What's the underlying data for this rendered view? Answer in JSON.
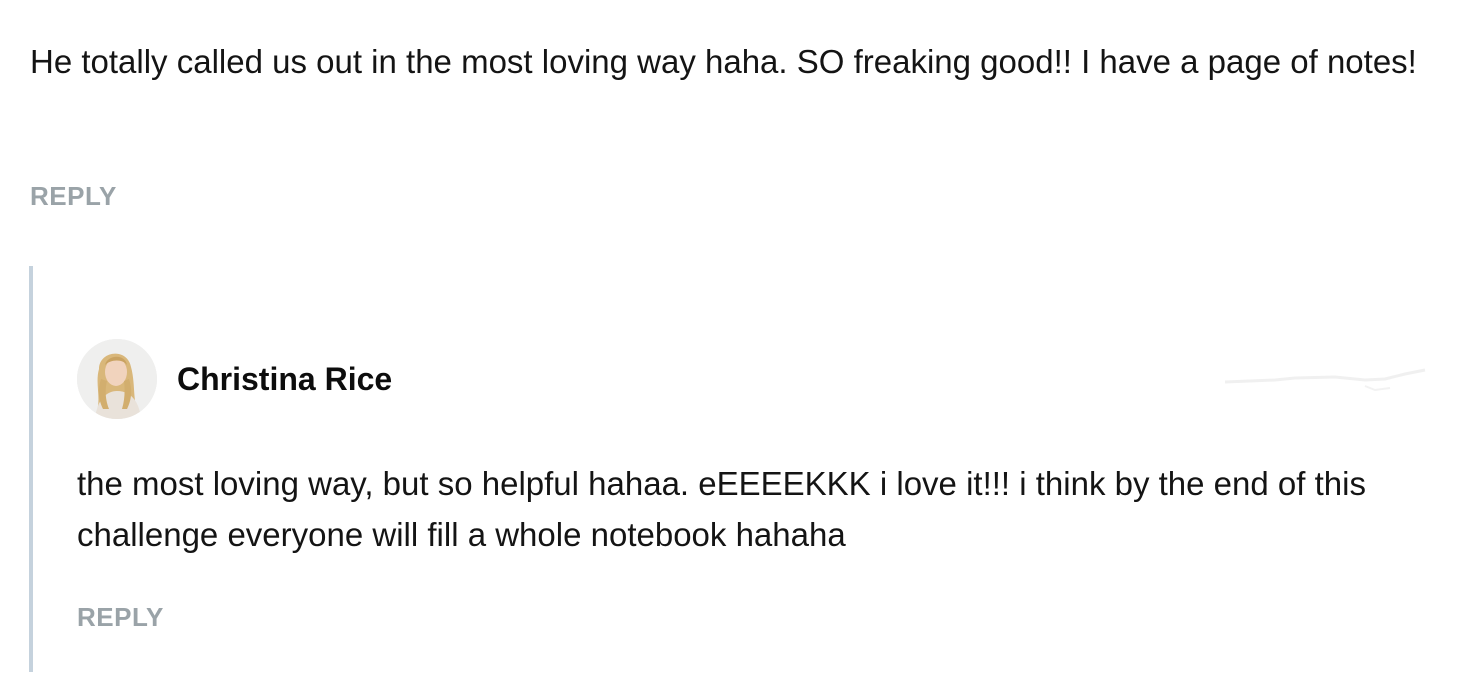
{
  "parent_comment": {
    "text": "He totally called us out in the most loving way haha. SO freaking good!! I have a page of notes!",
    "reply_label": "REPLY"
  },
  "child_comment": {
    "author": "Christina Rice",
    "avatar_icon": "avatar-photo",
    "text": "the most loving way, but so helpful hahaa. eEEEEKKK i love it!!! i think by the end of this challenge everyone will fill a whole notebook hahaha",
    "reply_label": "REPLY"
  },
  "colors": {
    "reply_link": "#9aa3a8",
    "thread_border": "#c5d2dd",
    "text": "#141414"
  }
}
